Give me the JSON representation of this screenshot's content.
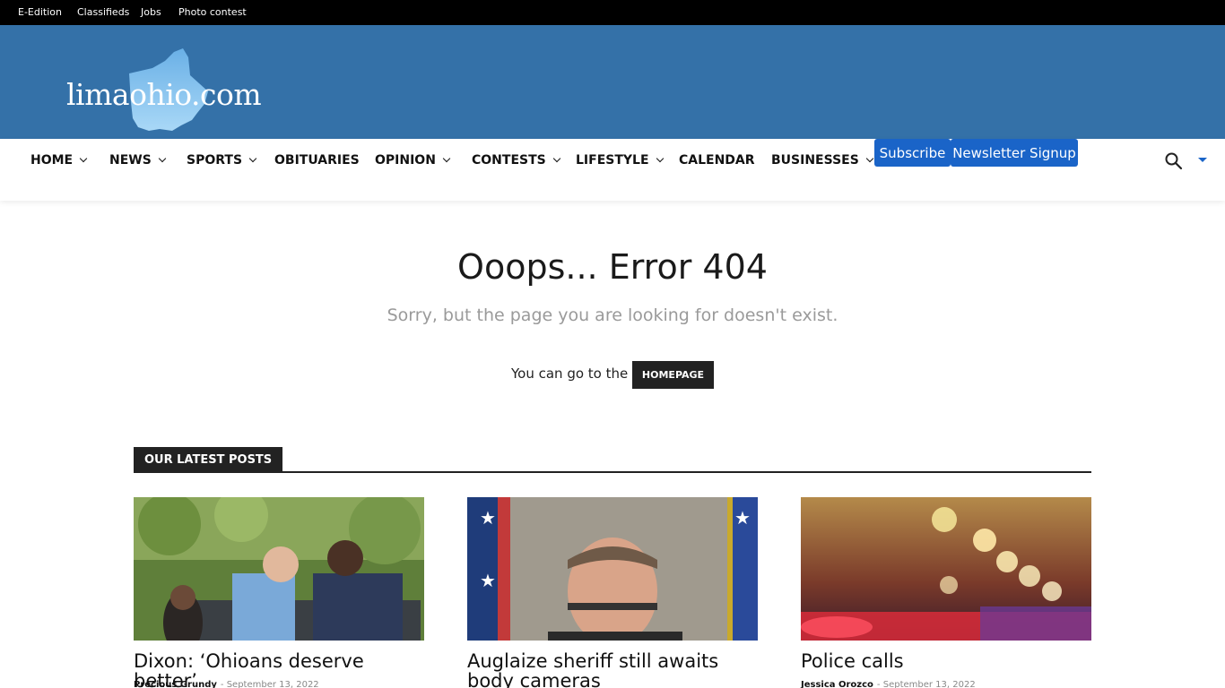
{
  "topbar": {
    "links": [
      "E-Edition",
      "Classifieds",
      "Jobs",
      "Photo contest"
    ]
  },
  "header": {
    "logo_text": "limaohio.com"
  },
  "nav": {
    "items": [
      {
        "label": "HOME"
      },
      {
        "label": "NEWS"
      },
      {
        "label": "SPORTS"
      },
      {
        "label": "OBITUARIES"
      },
      {
        "label": "OPINION"
      },
      {
        "label": "CONTESTS"
      },
      {
        "label": "LIFESTYLE"
      },
      {
        "label": "CALENDAR"
      },
      {
        "label": "BUSINESSES"
      }
    ],
    "subscribe_label": "Subscribe",
    "newsletter_label": "Newsletter Signup",
    "search_icon": "search-icon",
    "accent_color": "#1a64c8"
  },
  "error": {
    "title": "Ooops... Error 404",
    "subtitle": "Sorry, but the page you are looking for doesn't exist.",
    "goto_text": "You can go to the",
    "homepage_button": "HOMEPAGE"
  },
  "latest": {
    "heading": "OUR LATEST POSTS",
    "posts": [
      {
        "title": "Dixon: ‘Ohioans deserve better’",
        "author": "Precious Grundy",
        "date": "September 13, 2022"
      },
      {
        "title": "Auglaize sheriff still awaits body cameras",
        "author": "",
        "date": ""
      },
      {
        "title": "Police calls",
        "author": "Jessica Orozco",
        "date": "September 13, 2022"
      }
    ]
  },
  "colors": {
    "header_bg": "#3471a8",
    "topbar_bg": "#000000",
    "button_dark": "#222222"
  }
}
